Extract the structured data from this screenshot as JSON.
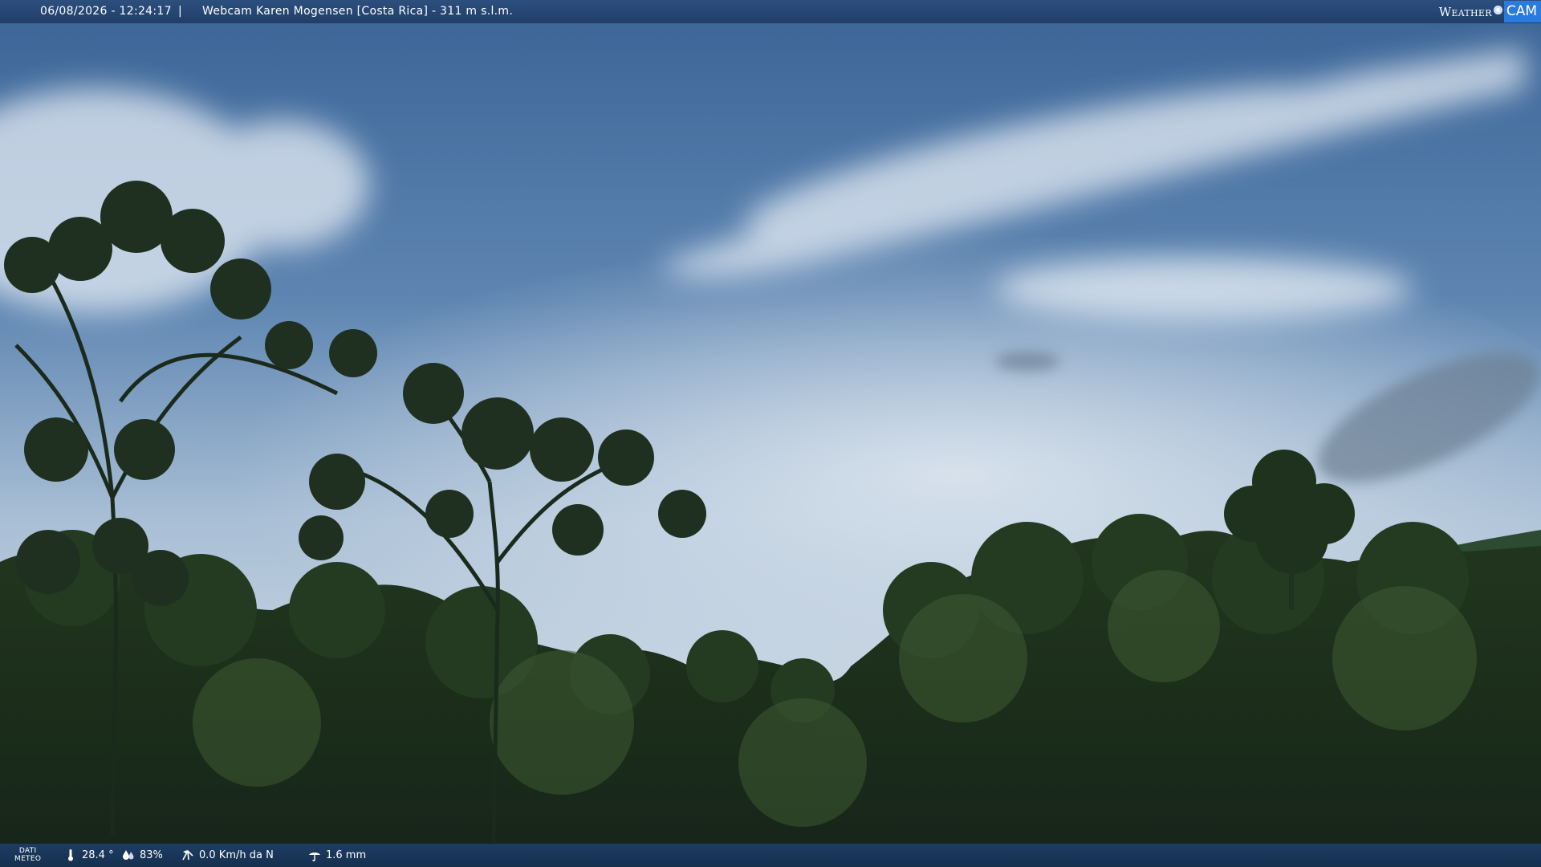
{
  "overlay": {
    "datetime": "06/08/2026 - 12:24:17",
    "separator": "|",
    "title": "Webcam Karen Mogensen [Costa Rica]  - 311 m s.l.m.",
    "logo_weather": "Weather",
    "logo_cam": "CAM"
  },
  "weather": {
    "label_line1": "DATI",
    "label_line2": "METEO",
    "temperature": "28.4 °",
    "humidity": "83%",
    "wind": "0.0 Km/h da N",
    "rain": "1.6 mm"
  },
  "colors": {
    "bar": "#203e68",
    "logo_accent": "#2a7be0"
  },
  "icons": [
    "thermometer-icon",
    "humidity-icon",
    "wind-icon",
    "rain-icon",
    "logo-dot-icon"
  ]
}
